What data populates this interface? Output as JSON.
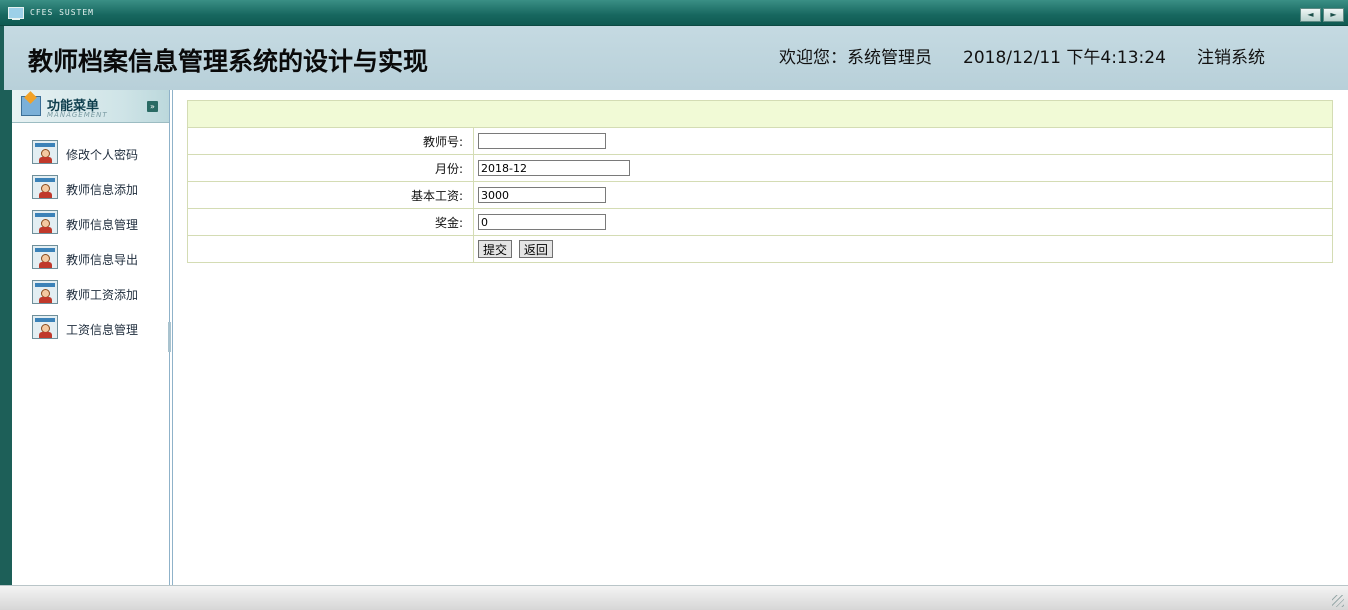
{
  "window": {
    "app_name": "CFES SUSTEM",
    "nav_prev": "◄",
    "nav_next": "►"
  },
  "header": {
    "title": "教师档案信息管理系统的设计与实现",
    "welcome": "欢迎您：系统管理员",
    "datetime": "2018/12/11 下午4:13:24",
    "logout": "注销系统"
  },
  "sidebar": {
    "menu_title": "功能菜单",
    "menu_subtitle": "MANAGEMENT",
    "collapse_glyph": "»",
    "items": [
      {
        "label": "修改个人密码"
      },
      {
        "label": "教师信息添加"
      },
      {
        "label": "教师信息管理"
      },
      {
        "label": "教师信息导出"
      },
      {
        "label": "教师工资添加"
      },
      {
        "label": "工资信息管理"
      }
    ]
  },
  "form": {
    "fields": [
      {
        "label": "教师号:",
        "value": ""
      },
      {
        "label": "月份:",
        "value": "2018-12"
      },
      {
        "label": "基本工资:",
        "value": "3000"
      },
      {
        "label": "奖金:",
        "value": "0"
      }
    ],
    "submit_label": "提交",
    "back_label": "返回"
  }
}
